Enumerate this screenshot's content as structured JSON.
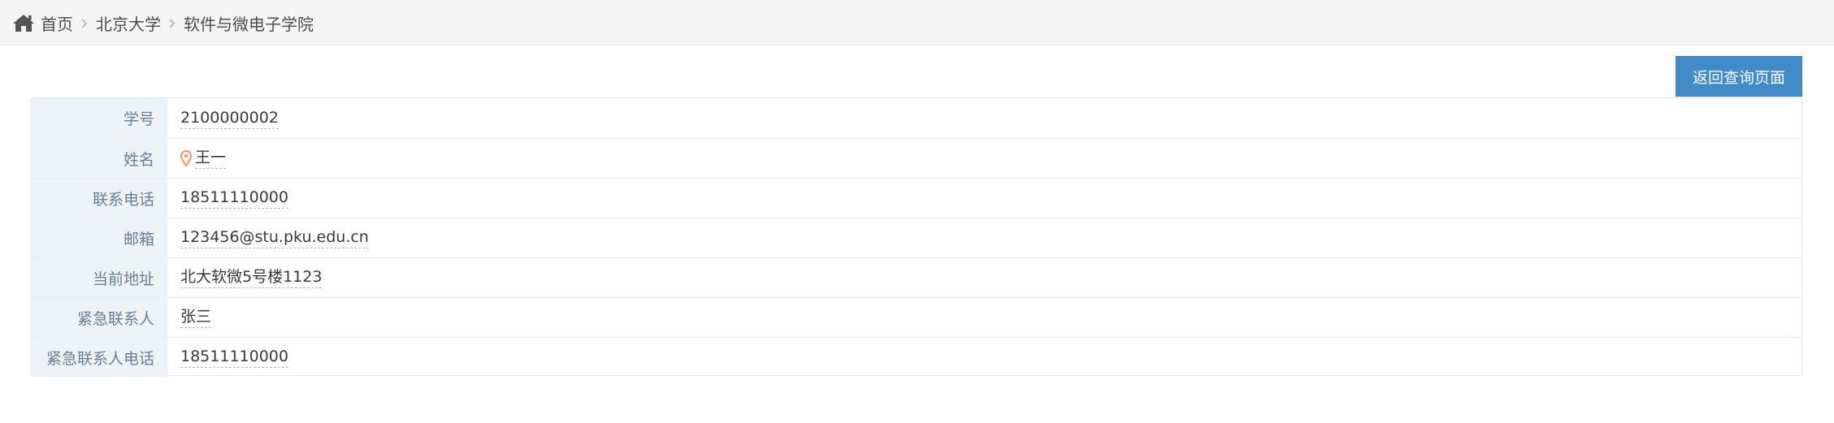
{
  "breadcrumb": {
    "home_label": "首页",
    "items": [
      "北京大学",
      "软件与微电子学院"
    ]
  },
  "actions": {
    "back_label": "返回查询页面"
  },
  "profile": {
    "rows": [
      {
        "label": "学号",
        "value": "2100000002"
      },
      {
        "label": "姓名",
        "value": "王一"
      },
      {
        "label": "联系电话",
        "value": "18511110000"
      },
      {
        "label": "邮箱",
        "value": "123456@stu.pku.edu.cn"
      },
      {
        "label": "当前地址",
        "value": "北大软微5号楼1123"
      },
      {
        "label": "紧急联系人",
        "value": "张三"
      },
      {
        "label": "紧急联系人电话",
        "value": "18511110000"
      }
    ]
  },
  "colors": {
    "accent": "#428bca",
    "label_bg": "#edf3f7",
    "pin": "#f79263"
  },
  "icons": {
    "home": "home-icon",
    "pin": "map-marker-icon",
    "separator": "chevron-right-icon"
  }
}
